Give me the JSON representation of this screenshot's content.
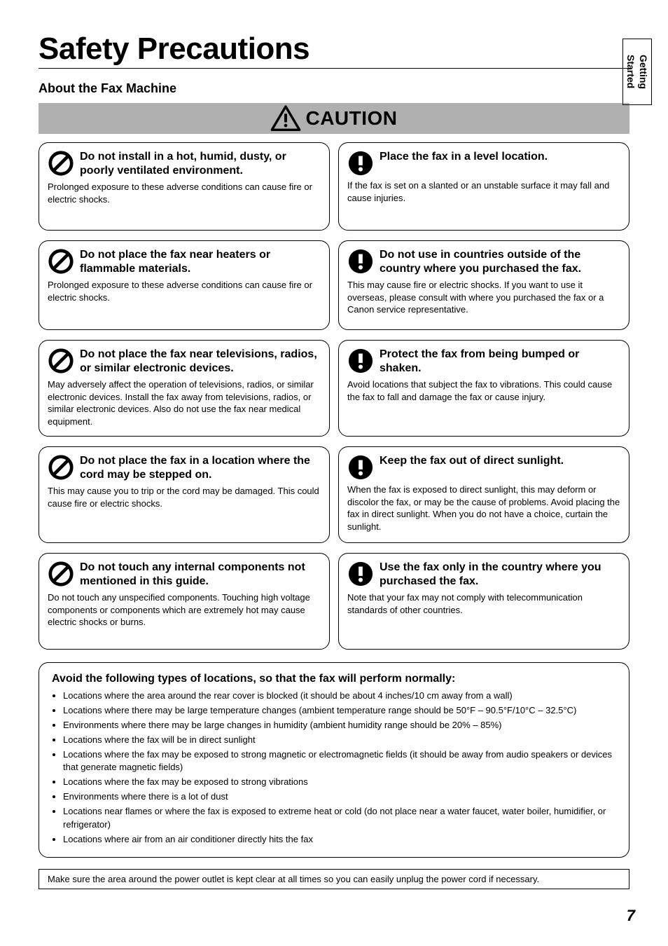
{
  "side_tab": "Getting Started",
  "page_title": "Safety Precautions",
  "subhead": "About the Fax Machine",
  "caution_label": "CAUTION",
  "cards": {
    "left": [
      {
        "title": "Do not install in a hot, humid, dusty, or poorly ventilated environment.",
        "body": "Prolonged exposure to these adverse conditions can cause fire or electric shocks."
      },
      {
        "title": "Do not place the fax near heaters or flammable materials.",
        "body": "Prolonged exposure to these adverse conditions can cause fire or electric shocks."
      },
      {
        "title": "Do not place the fax near televisions, radios, or similar electronic devices.",
        "body": "May adversely affect the operation of televisions, radios, or similar electronic devices. Install the fax away from televisions, radios, or similar electronic devices. Also do not use the fax near medical equipment."
      },
      {
        "title": "Do not place the fax in a location where the cord may be stepped on.",
        "body": "This may cause you to trip or the cord may be damaged. This could cause fire or electric shocks."
      },
      {
        "title": "Do not touch any internal components not mentioned in this guide.",
        "body": "Do not touch any unspecified components. Touching high voltage components or components which are extremely hot may cause electric shocks or burns."
      }
    ],
    "right": [
      {
        "title": "Place the fax in a level location.",
        "body": "If the fax is set on a slanted or an unstable surface it may fall and cause injuries."
      },
      {
        "title": "Do not use in countries outside of the country where you purchased the fax.",
        "body": "This may cause fire or electric shocks. If you want to use it overseas, please consult with where you purchased the fax or a Canon service representative."
      },
      {
        "title": "Protect the fax from being bumped or shaken.",
        "body": "Avoid locations that subject the fax to vibrations. This could cause the fax to fall and damage the fax or cause injury."
      },
      {
        "title": "Keep the fax out of direct sunlight.",
        "body": "When the fax is exposed to direct sunlight, this may deform or discolor the fax, or may be the cause of problems. Avoid placing the fax in direct sunlight. When you do not have a choice, curtain the sunlight."
      },
      {
        "title": "Use the fax only in the country where you purchased the fax.",
        "body": "Note that your fax may not comply with telecommunication standards of other countries."
      }
    ]
  },
  "wide": {
    "heading": "Avoid the following types of locations, so that the fax will perform normally:",
    "bullets": [
      "Locations where the area around the rear cover is blocked (it should be about 4 inches/10 cm away from a wall)",
      "Locations where there may be large temperature changes (ambient temperature range should be 50°F – 90.5°F/10°C – 32.5°C)",
      "Environments where there may be large changes in humidity (ambient humidity range should be 20% – 85%)",
      "Locations where the fax will be in direct sunlight",
      "Locations where the fax may be exposed to strong magnetic or electromagnetic fields (it should be away from audio speakers or devices that generate magnetic fields)",
      "Locations where the fax may be exposed to strong vibrations",
      "Environments where there is a lot of dust",
      "Locations near flames or where the fax is exposed to extreme heat or cold (do not place near a water faucet, water boiler, humidifier, or refrigerator)",
      "Locations where air from an air conditioner directly hits the fax"
    ]
  },
  "footer": "Make sure the area around the power outlet is kept clear at all times so you can easily unplug the power cord if necessary.",
  "page_number": "7"
}
